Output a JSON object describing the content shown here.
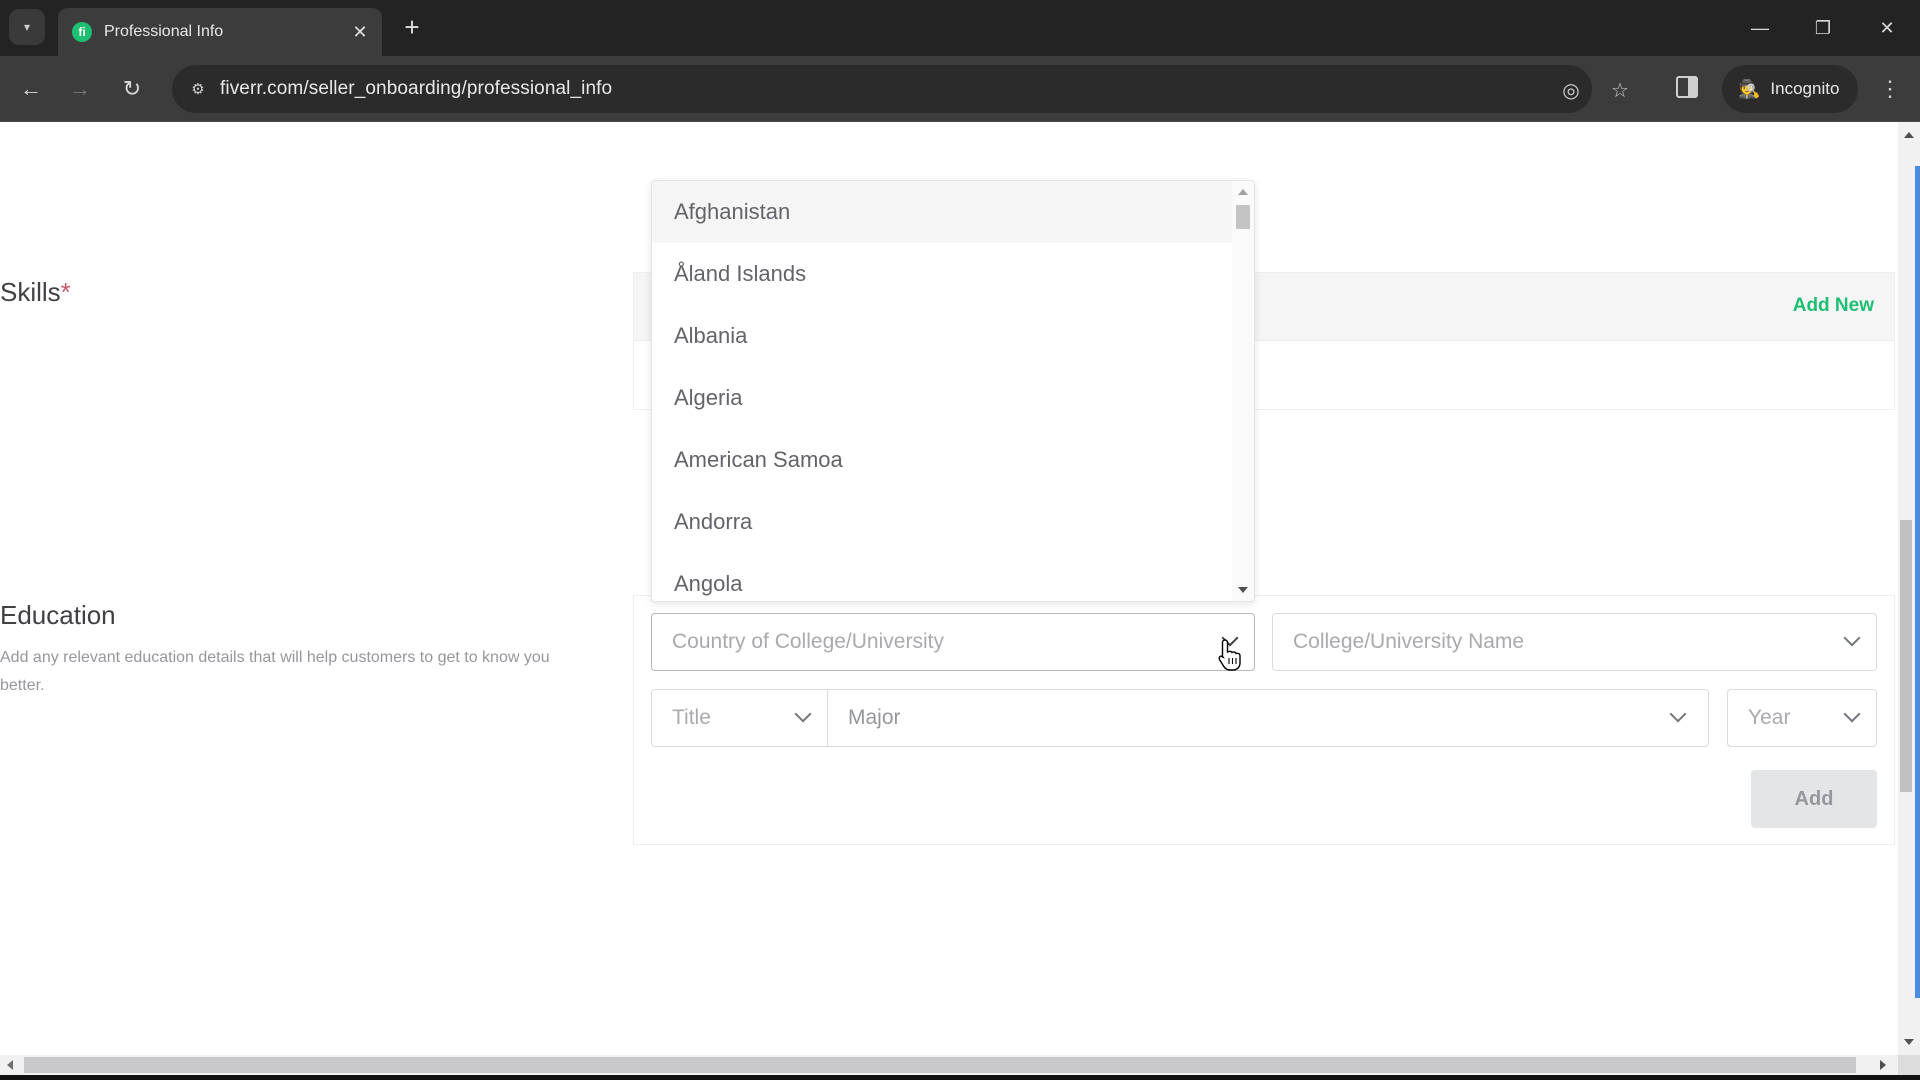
{
  "browser": {
    "tab_title": "Professional Info",
    "tab_favicon_letter": "fi",
    "url": "fiverr.com/seller_onboarding/professional_info",
    "profile_label": "Incognito",
    "icons": {
      "tab_list": "▾",
      "close_tab": "✕",
      "new_tab": "+",
      "minimize": "—",
      "restore": "❐",
      "close_window": "✕",
      "back": "←",
      "forward": "→",
      "reload": "↻",
      "site_info": "⚙",
      "eye_off": "◎",
      "bookmark": "☆",
      "incognito": "🕵",
      "menu": "⋮"
    }
  },
  "page": {
    "skills": {
      "label": "Skills",
      "required_mark": "*",
      "add_new_label": "Add New"
    },
    "education": {
      "label": "Education",
      "description": "Add any relevant education details that will help customers to get to know you better.",
      "country_placeholder": "Country of College/University",
      "college_placeholder": "College/University Name",
      "title_placeholder": "Title",
      "major_placeholder": "Major",
      "year_placeholder": "Year",
      "add_button_label": "Add"
    },
    "country_dropdown": {
      "options": [
        "Afghanistan",
        "Åland Islands",
        "Albania",
        "Algeria",
        "American Samoa",
        "Andorra",
        "Angola"
      ],
      "highlighted_index": 0
    }
  },
  "colors": {
    "brand_green": "#1dbf73",
    "required_red": "#c7576a",
    "focus_blue": "#4a8ce0"
  }
}
